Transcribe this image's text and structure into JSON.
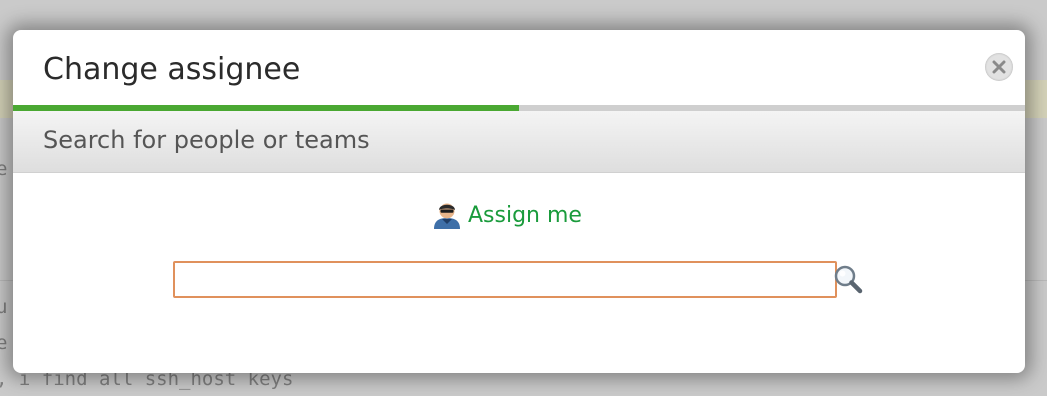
{
  "background": {
    "text_lines": [
      "e",
      "u",
      "e",
      ", i find all ssh_host keys"
    ]
  },
  "dialog": {
    "title": "Change assignee",
    "close_icon": "close-icon",
    "progress_fraction": 0.5,
    "subheader": "Search for people or teams",
    "assign_me": {
      "label": "Assign me",
      "icon": "user-avatar-icon"
    },
    "search": {
      "value": "",
      "placeholder": "",
      "icon": "magnifier-icon"
    }
  },
  "colors": {
    "progress": "#4aa832",
    "link": "#1a9b3c",
    "input_border": "#e0915c"
  }
}
